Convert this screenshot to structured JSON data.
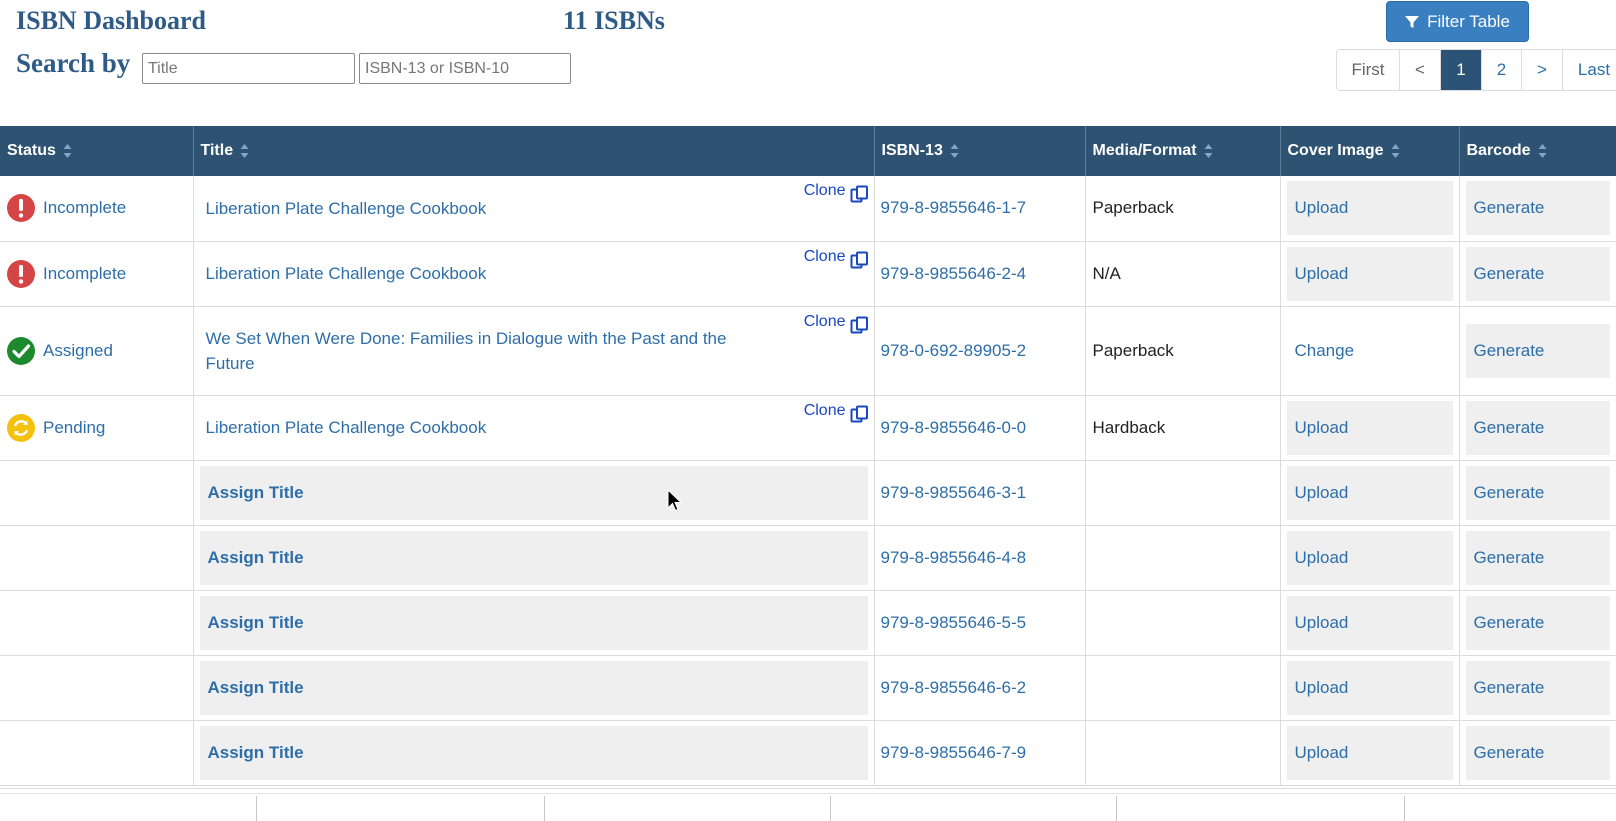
{
  "header": {
    "title": "ISBN Dashboard",
    "count": "11 ISBNs",
    "search_label": "Search by",
    "title_placeholder": "Title",
    "isbn_placeholder": "ISBN-13 or ISBN-10",
    "filter_button": "Filter Table"
  },
  "pagination": {
    "first": "First",
    "prev": "<",
    "pages": [
      "1",
      "2"
    ],
    "current": "1",
    "next": ">",
    "last": "Last"
  },
  "table": {
    "columns": [
      "Status",
      "Title",
      "ISBN-13",
      "Media/Format",
      "Cover Image",
      "Barcode"
    ],
    "clone_label": "Clone",
    "rows": [
      {
        "status": "Incomplete",
        "status_icon": "error-icon",
        "title": "Liberation Plate Challenge Cookbook",
        "isbn": "979-8-9855646-1-7",
        "format": "Paperback",
        "cover": "Upload",
        "barcode": "Generate"
      },
      {
        "status": "Incomplete",
        "status_icon": "error-icon",
        "title": "Liberation Plate Challenge Cookbook",
        "isbn": "979-8-9855646-2-4",
        "format": "N/A",
        "cover": "Upload",
        "barcode": "Generate"
      },
      {
        "status": "Assigned",
        "status_icon": "check-icon",
        "title": "We Set When Were Done: Families in Dialogue with the Past and the Future",
        "isbn": "978-0-692-89905-2",
        "format": "Paperback",
        "cover": "Change",
        "barcode": "Generate"
      },
      {
        "status": "Pending",
        "status_icon": "pending-icon",
        "title": "Liberation Plate Challenge Cookbook",
        "isbn": "979-8-9855646-0-0",
        "format": "Hardback",
        "cover": "Upload",
        "barcode": "Generate"
      },
      {
        "status": "",
        "title": "Assign Title",
        "isbn": "979-8-9855646-3-1",
        "format": "",
        "cover": "Upload",
        "barcode": "Generate"
      },
      {
        "status": "",
        "title": "Assign Title",
        "isbn": "979-8-9855646-4-8",
        "format": "",
        "cover": "Upload",
        "barcode": "Generate"
      },
      {
        "status": "",
        "title": "Assign Title",
        "isbn": "979-8-9855646-5-5",
        "format": "",
        "cover": "Upload",
        "barcode": "Generate"
      },
      {
        "status": "",
        "title": "Assign Title",
        "isbn": "979-8-9855646-6-2",
        "format": "",
        "cover": "Upload",
        "barcode": "Generate"
      },
      {
        "status": "",
        "title": "Assign Title",
        "isbn": "979-8-9855646-7-9",
        "format": "",
        "cover": "Upload",
        "barcode": "Generate"
      }
    ]
  },
  "colors": {
    "heading": "#2d5a86",
    "table_header": "#2e5272",
    "link": "#2d6ea8",
    "filter_button": "#3a7fc0",
    "error": "#d64545",
    "success": "#1e8a2e",
    "pending": "#f4c20d"
  }
}
